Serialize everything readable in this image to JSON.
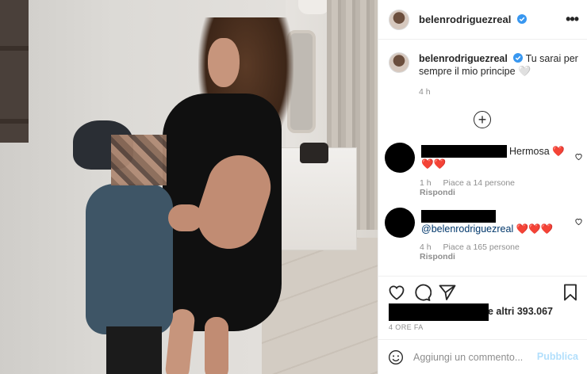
{
  "header": {
    "username": "belenrodriguezreal",
    "verified_color": "#3897f0"
  },
  "caption": {
    "username": "belenrodriguezreal",
    "text": "Tu sarai per sempre il mio principe",
    "emoji": "🤍",
    "time": "4 h"
  },
  "load_more_icon": "plus-circle-icon",
  "comments": [
    {
      "text": "Hermosa",
      "emoji": "❤️",
      "emoji_line2": "❤️❤️",
      "time": "1 h",
      "likes": "Piace a 14 persone",
      "reply": "Rispondi"
    },
    {
      "mention": "@belenrodriguezreal",
      "emoji": "❤️❤️❤️",
      "time": "4 h",
      "likes": "Piace a 165 persone",
      "reply": "Rispondi"
    }
  ],
  "likes": {
    "text": "e altri 393.067"
  },
  "post_time": "4 ORE FA",
  "add_comment": {
    "placeholder": "Aggiungi un commento...",
    "publish_label": "Pubblica"
  },
  "colors": {
    "text": "#262626",
    "secondary": "#8e8e8e",
    "publish_disabled": "#b2dffc",
    "heart": "#e0261b",
    "border": "#efefef"
  }
}
